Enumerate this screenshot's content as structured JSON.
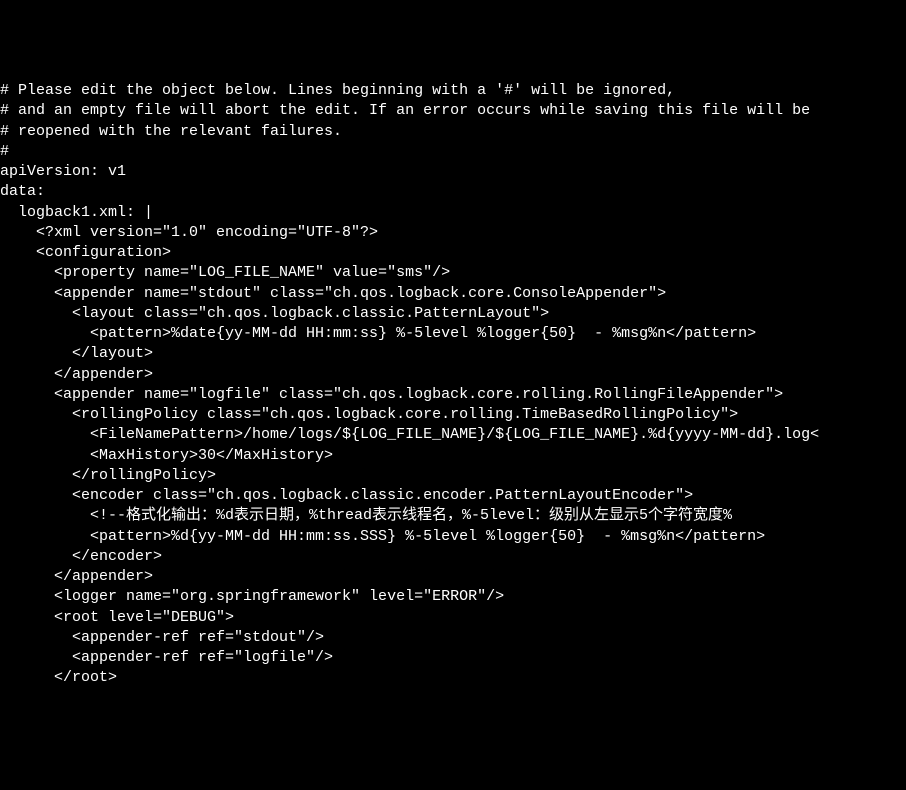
{
  "lines": [
    "# Please edit the object below. Lines beginning with a '#' will be ignored,",
    "# and an empty file will abort the edit. If an error occurs while saving this file will be",
    "# reopened with the relevant failures.",
    "#",
    "apiVersion: v1",
    "data:",
    "  logback1.xml: |",
    "    <?xml version=\"1.0\" encoding=\"UTF-8\"?>",
    "    <configuration>",
    "      <property name=\"LOG_FILE_NAME\" value=\"sms\"/>",
    "      <appender name=\"stdout\" class=\"ch.qos.logback.core.ConsoleAppender\">",
    "        <layout class=\"ch.qos.logback.classic.PatternLayout\">",
    "          <pattern>%date{yy-MM-dd HH:mm:ss} %-5level %logger{50}  - %msg%n</pattern>",
    "        </layout>",
    "      </appender>",
    "      <appender name=\"logfile\" class=\"ch.qos.logback.core.rolling.RollingFileAppender\">",
    "        <rollingPolicy class=\"ch.qos.logback.core.rolling.TimeBasedRollingPolicy\">",
    "          <FileNamePattern>/home/logs/${LOG_FILE_NAME}/${LOG_FILE_NAME}.%d{yyyy-MM-dd}.log<",
    "          <MaxHistory>30</MaxHistory>",
    "        </rollingPolicy>",
    "        <encoder class=\"ch.qos.logback.classic.encoder.PatternLayoutEncoder\">",
    "          <!--格式化输出：%d表示日期，%thread表示线程名，%-5level：级别从左显示5个字符宽度%",
    "          <pattern>%d{yy-MM-dd HH:mm:ss.SSS} %-5level %logger{50}  - %msg%n</pattern>",
    "        </encoder>",
    "      </appender>",
    "      <logger name=\"org.springframework\" level=\"ERROR\"/>",
    "      <root level=\"DEBUG\">",
    "        <appender-ref ref=\"stdout\"/>",
    "        <appender-ref ref=\"logfile\"/>",
    "      </root>"
  ]
}
